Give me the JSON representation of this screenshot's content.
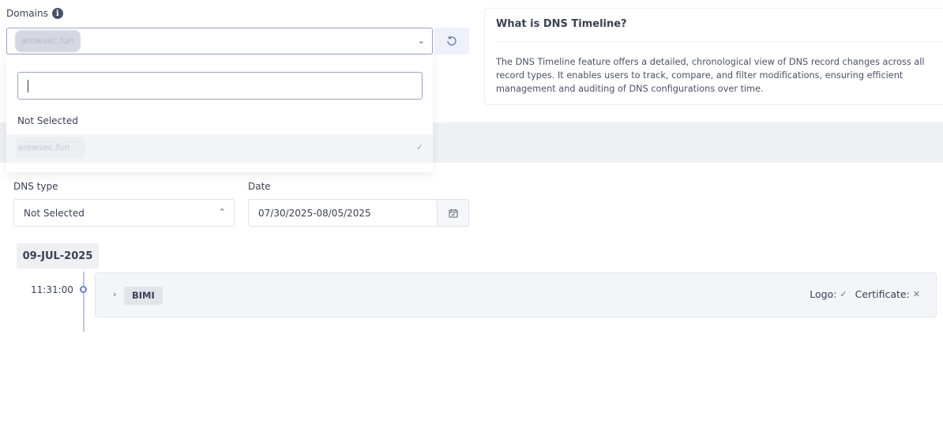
{
  "domains": {
    "label": "Domains",
    "selected": "arowsec.fun",
    "dropdown": {
      "search_value": "",
      "not_selected_label": "Not Selected",
      "options": [
        {
          "label": "arowsec.fun",
          "selected": true
        }
      ]
    }
  },
  "info": {
    "title": "What is DNS Timeline?",
    "text": "The DNS Timeline feature offers a detailed, chronological view of DNS record changes across all record types. It enables users to track, compare, and filter modifications, ensuring efficient management and auditing of DNS configurations over time."
  },
  "filters": {
    "dns_type_label": "DNS type",
    "dns_type_value": "Not Selected",
    "date_label": "Date",
    "date_value": "07/30/2025-08/05/2025"
  },
  "timeline": {
    "date": "09-JUL-2025",
    "entries": [
      {
        "time": "11:31:00",
        "record_type": "BIMI",
        "logo_label": "Logo:",
        "certificate_label": "Certificate:"
      }
    ]
  },
  "colors": {
    "accent": "#6f7ed0",
    "border_active": "#9aa3c9",
    "band": "#eff0f4"
  }
}
